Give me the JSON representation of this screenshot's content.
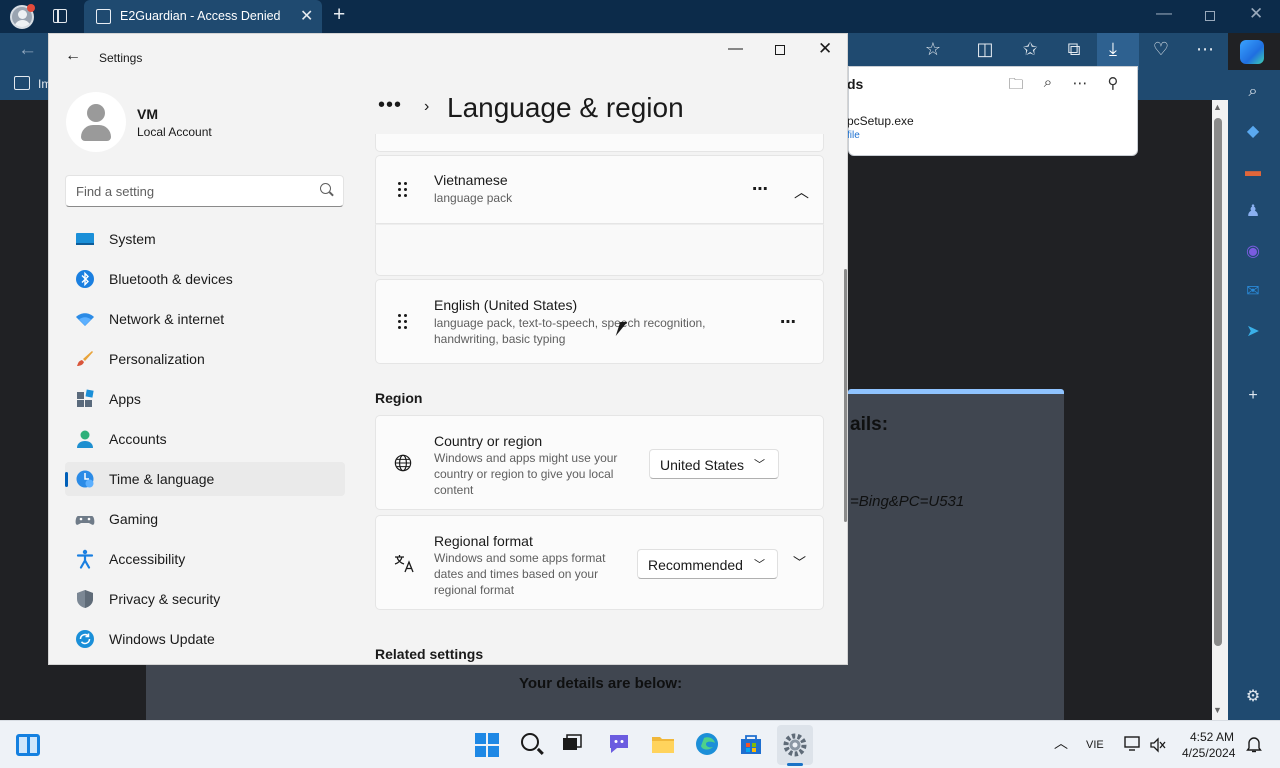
{
  "browser": {
    "tab_title": "E2Guardian - Access Denied",
    "fav_partial": "Im"
  },
  "downloads": {
    "title_partial": "ds",
    "file_partial": "pcSetup.exe",
    "link_partial": "file"
  },
  "page": {
    "details_heading_partial": "ails:",
    "details_line_partial": "=Bing&PC=U531",
    "details_below": "Your details are below:"
  },
  "settings": {
    "window_title": "Settings",
    "user": {
      "name": "VM",
      "account_type": "Local Account"
    },
    "search": {
      "placeholder": "Find a setting"
    },
    "nav": [
      {
        "label": "System",
        "icon": "system-icon"
      },
      {
        "label": "Bluetooth & devices",
        "icon": "bluetooth-icon"
      },
      {
        "label": "Network & internet",
        "icon": "wifi-icon"
      },
      {
        "label": "Personalization",
        "icon": "brush-icon"
      },
      {
        "label": "Apps",
        "icon": "apps-icon"
      },
      {
        "label": "Accounts",
        "icon": "accounts-icon"
      },
      {
        "label": "Time & language",
        "icon": "time-language-icon",
        "active": true
      },
      {
        "label": "Gaming",
        "icon": "gamepad-icon"
      },
      {
        "label": "Accessibility",
        "icon": "accessibility-icon"
      },
      {
        "label": "Privacy & security",
        "icon": "shield-icon"
      },
      {
        "label": "Windows Update",
        "icon": "update-icon"
      }
    ],
    "breadcrumb_dots": "•••",
    "page_title": "Language & region",
    "languages": [
      {
        "name": "Vietnamese",
        "features": "language pack"
      },
      {
        "name": "English (United States)",
        "features_line1": "language pack, text-to-speech, speech recognition,",
        "features_line2": "handwriting, basic typing"
      }
    ],
    "region": {
      "heading": "Region",
      "country": {
        "title": "Country or region",
        "desc_line1": "Windows and apps might use your",
        "desc_line2": "country or region to give you local",
        "desc_line3": "content",
        "value": "United States"
      },
      "format": {
        "title": "Regional format",
        "desc_line1": "Windows and some apps format",
        "desc_line2": "dates and times based on your",
        "desc_line3": "regional format",
        "value": "Recommended"
      }
    },
    "related_heading": "Related settings"
  },
  "taskbar": {
    "tray_lang": "VIE",
    "time": "4:52 AM",
    "date": "4/25/2024"
  },
  "colors": {
    "accent": "#005fb8",
    "browser_dark": "#0c2b4a",
    "browser_toolbar": "#1f4a70"
  }
}
